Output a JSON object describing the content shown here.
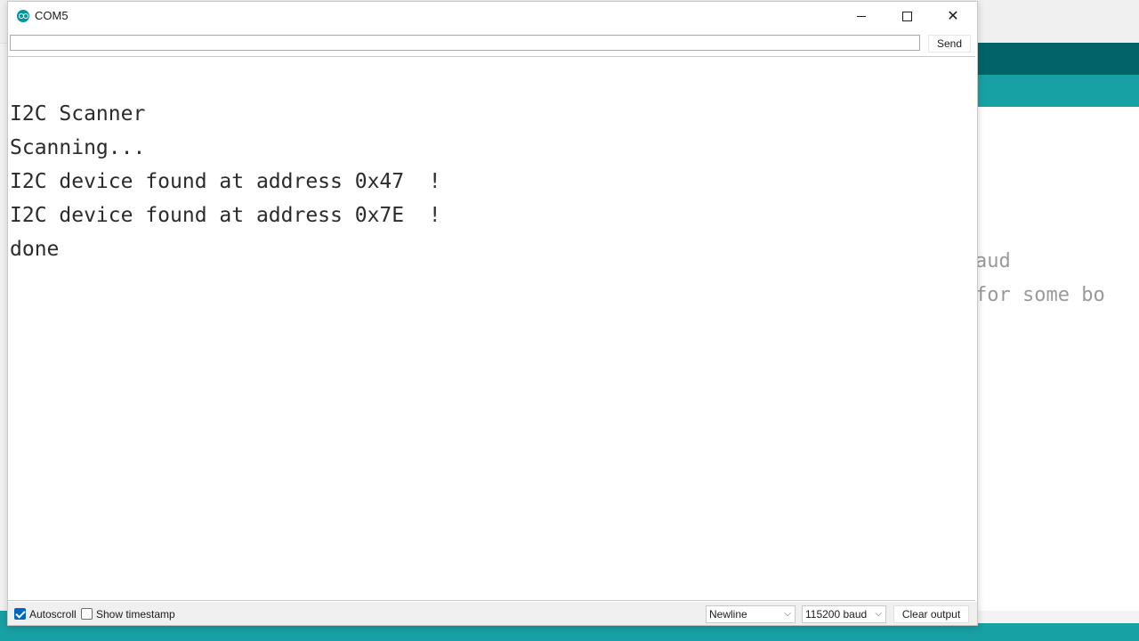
{
  "background": {
    "line1": "aud",
    "line2": "for some bo"
  },
  "window": {
    "title": "COM5",
    "icon": "arduino-icon",
    "controls": {
      "minimize_icon": "minimize-icon",
      "maximize_icon": "maximize-icon",
      "close_icon": "close-icon",
      "close_glyph": "✕"
    }
  },
  "send_bar": {
    "input_value": "",
    "input_placeholder": "",
    "send_label": "Send"
  },
  "output": {
    "lines": [
      "I2C Scanner",
      "Scanning...",
      "I2C device found at address 0x47  !",
      "I2C device found at address 0x7E  !",
      "done"
    ]
  },
  "bottom_bar": {
    "autoscroll_label": "Autoscroll",
    "autoscroll_checked": true,
    "timestamp_label": "Show timestamp",
    "timestamp_checked": false,
    "line_ending_value": "Newline",
    "baud_value": "115200 baud",
    "clear_label": "Clear output",
    "chevron_icon": "chevron-down-icon"
  },
  "colors": {
    "accent": "#0067c0",
    "arduino_teal_dark": "#006468",
    "arduino_teal_light": "#17a1a5"
  }
}
